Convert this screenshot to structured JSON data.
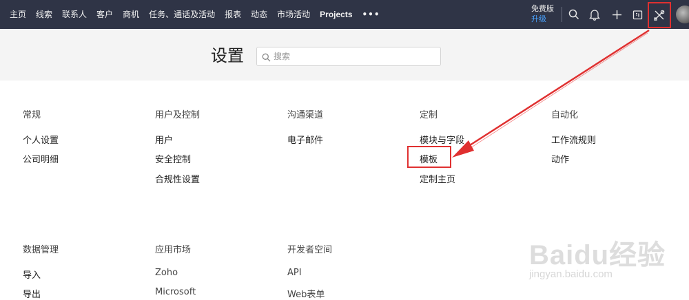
{
  "nav": {
    "items": [
      {
        "label": "主页"
      },
      {
        "label": "线索"
      },
      {
        "label": "联系人"
      },
      {
        "label": "客户"
      },
      {
        "label": "商机"
      },
      {
        "label": "任务、通话及活动"
      },
      {
        "label": "报表"
      },
      {
        "label": "动态"
      },
      {
        "label": "市场活动"
      },
      {
        "label": "Projects"
      },
      {
        "label": "•••"
      }
    ],
    "plan_name": "免费版",
    "plan_upgrade": "升级"
  },
  "icons": {
    "search": "search-icon",
    "notifications": "bell-icon",
    "create": "plus-icon",
    "calendar": "calendar-icon",
    "setup": "tools-icon",
    "profile": "avatar"
  },
  "header": {
    "title": "设置",
    "search_placeholder": "搜索"
  },
  "sections_row1": [
    {
      "title": "常规",
      "links": [
        "个人设置",
        "公司明细"
      ]
    },
    {
      "title": "用户及控制",
      "links": [
        "用户",
        "安全控制",
        "合规性设置"
      ]
    },
    {
      "title": "沟通渠道",
      "links": [
        "电子邮件"
      ]
    },
    {
      "title": "定制",
      "links": [
        "模块与字段",
        "模板",
        "定制主页"
      ]
    },
    {
      "title": "自动化",
      "links": [
        "工作流规则",
        "动作"
      ]
    }
  ],
  "sections_row2": [
    {
      "title": "数据管理",
      "links": [
        "导入",
        "导出"
      ]
    },
    {
      "title": "应用市场",
      "links": [
        "Zoho",
        "Microsoft"
      ]
    },
    {
      "title": "开发者空间",
      "links": [
        "API",
        "Web表单"
      ]
    }
  ],
  "watermark": {
    "brand": "Baidu经验",
    "url": "jingyan.baidu.com"
  },
  "colors": {
    "topbar": "#2f3446",
    "accent_upgrade": "#4aa3ff",
    "annotation": "#e03030"
  }
}
